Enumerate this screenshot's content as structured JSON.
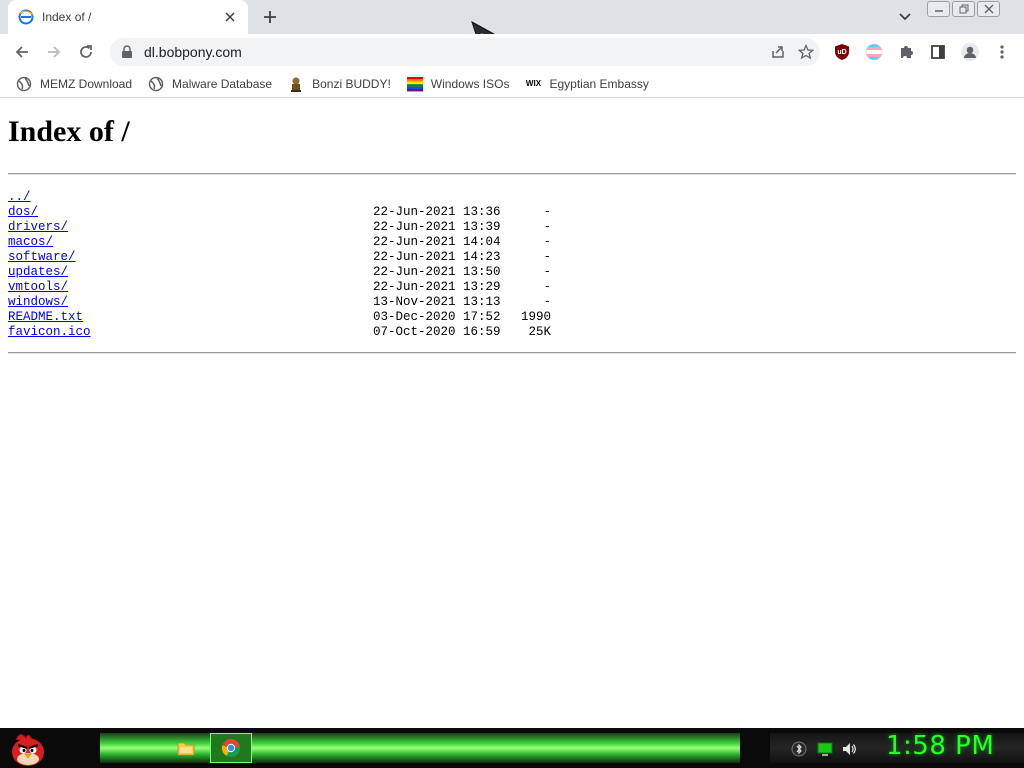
{
  "browser": {
    "tab": {
      "title": "Index of /"
    },
    "address": {
      "url": "dl.bobpony.com"
    },
    "bookmarks": [
      {
        "label": "MEMZ Download",
        "icon": "globe-icon"
      },
      {
        "label": "Malware Database",
        "icon": "globe-icon"
      },
      {
        "label": "Bonzi BUDDY!",
        "icon": "bonzi-icon"
      },
      {
        "label": "Windows ISOs",
        "icon": "rainbow-flag-icon"
      },
      {
        "label": "Egyptian Embassy",
        "icon": "wix-icon"
      }
    ],
    "wix_icon_text": "WIX",
    "ublock_text": "uD"
  },
  "page": {
    "heading": "Index of /",
    "parent_link": "../",
    "entries": [
      {
        "name": "dos/",
        "date": "22-Jun-2021 13:36",
        "size": "-"
      },
      {
        "name": "drivers/",
        "date": "22-Jun-2021 13:39",
        "size": "-"
      },
      {
        "name": "macos/",
        "date": "22-Jun-2021 14:04",
        "size": "-"
      },
      {
        "name": "software/",
        "date": "22-Jun-2021 14:23",
        "size": "-"
      },
      {
        "name": "updates/",
        "date": "22-Jun-2021 13:50",
        "size": "-"
      },
      {
        "name": "vmtools/",
        "date": "22-Jun-2021 13:29",
        "size": "-"
      },
      {
        "name": "windows/",
        "date": "13-Nov-2021 13:13",
        "size": "-"
      },
      {
        "name": "README.txt",
        "date": "03-Dec-2020 17:52",
        "size": "1990"
      },
      {
        "name": "favicon.ico",
        "date": "07-Oct-2020 16:59",
        "size": "25K"
      }
    ]
  },
  "taskbar": {
    "clock": "1:58 PM"
  },
  "colors": {
    "link": "#0000ee",
    "clock": "#28ff28",
    "taskbar_glow": "#3fd43f"
  }
}
